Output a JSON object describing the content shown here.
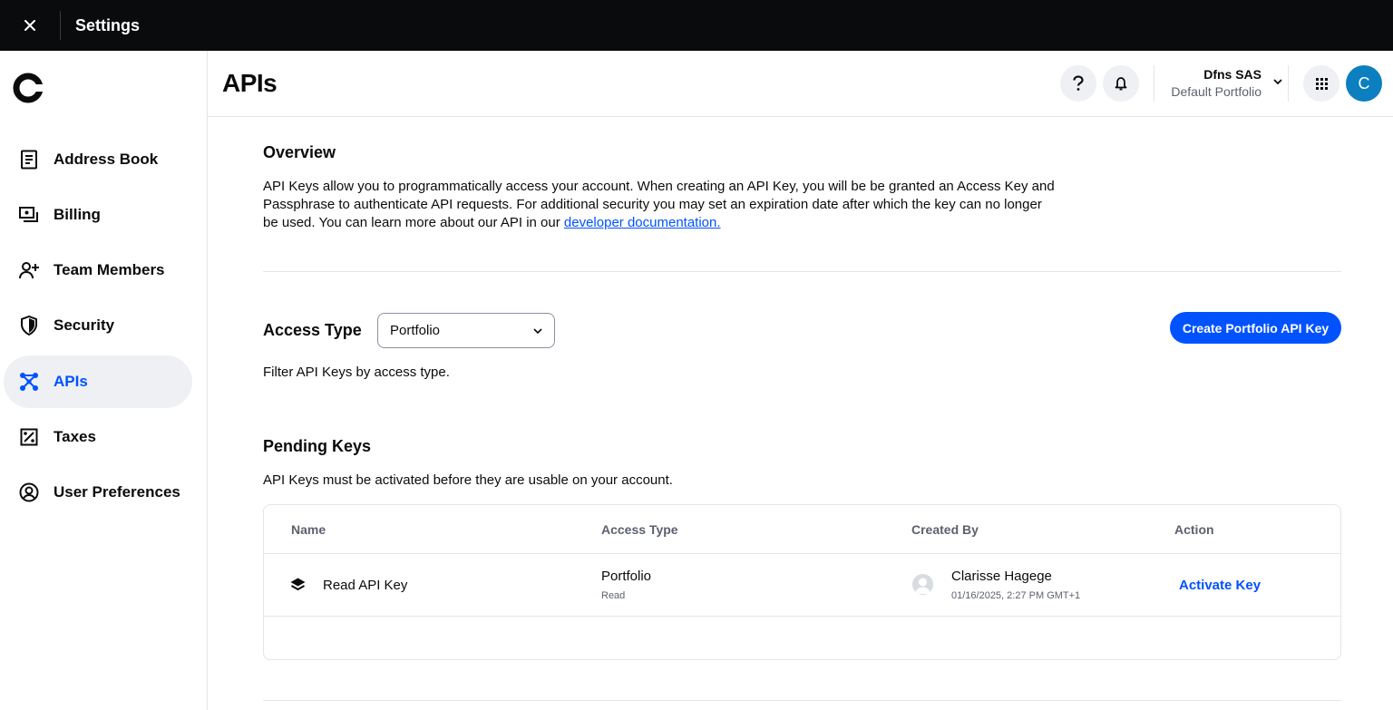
{
  "topbar": {
    "title": "Settings",
    "close_icon": "close-icon"
  },
  "sidebar": {
    "items": [
      {
        "label": "Address Book",
        "icon": "address-book-icon"
      },
      {
        "label": "Billing",
        "icon": "billing-icon"
      },
      {
        "label": "Team Members",
        "icon": "team-members-icon"
      },
      {
        "label": "Security",
        "icon": "shield-icon"
      },
      {
        "label": "APIs",
        "icon": "apis-icon",
        "active": true
      },
      {
        "label": "Taxes",
        "icon": "taxes-icon"
      },
      {
        "label": "User Preferences",
        "icon": "user-circle-icon"
      }
    ]
  },
  "header": {
    "title": "APIs",
    "org_name": "Dfns SAS",
    "portfolio_name": "Default Portfolio",
    "avatar_initial": "C"
  },
  "overview": {
    "heading": "Overview",
    "text_line1": "API Keys allow you to programmatically access your account. When creating an API Key, you will be be granted an Access Key and",
    "text_line2": "Passphrase to authenticate API requests. For additional security you may set an expiration date after which the key can no longer",
    "text_line3": "be used. You can learn more about our API in our ",
    "link_text": "developer documentation."
  },
  "access_type": {
    "label": "Access Type",
    "selected": "Portfolio",
    "helper": "Filter API Keys by access type.",
    "create_button": "Create Portfolio API Key"
  },
  "pending": {
    "heading": "Pending Keys",
    "description": "API Keys must be activated before they are usable on your account.",
    "columns": [
      "Name",
      "Access Type",
      "Created By",
      "Action"
    ],
    "rows": [
      {
        "name": "Read API Key",
        "access_type": "Portfolio",
        "access_sub": "Read",
        "created_by": "Clarisse Hagege",
        "created_at": "01/16/2025, 2:27 PM GMT+1",
        "action": "Activate Key"
      }
    ]
  },
  "colors": {
    "accent": "#0052ff",
    "topbar": "#0a0b0d",
    "active_bg": "#eef0f3"
  }
}
